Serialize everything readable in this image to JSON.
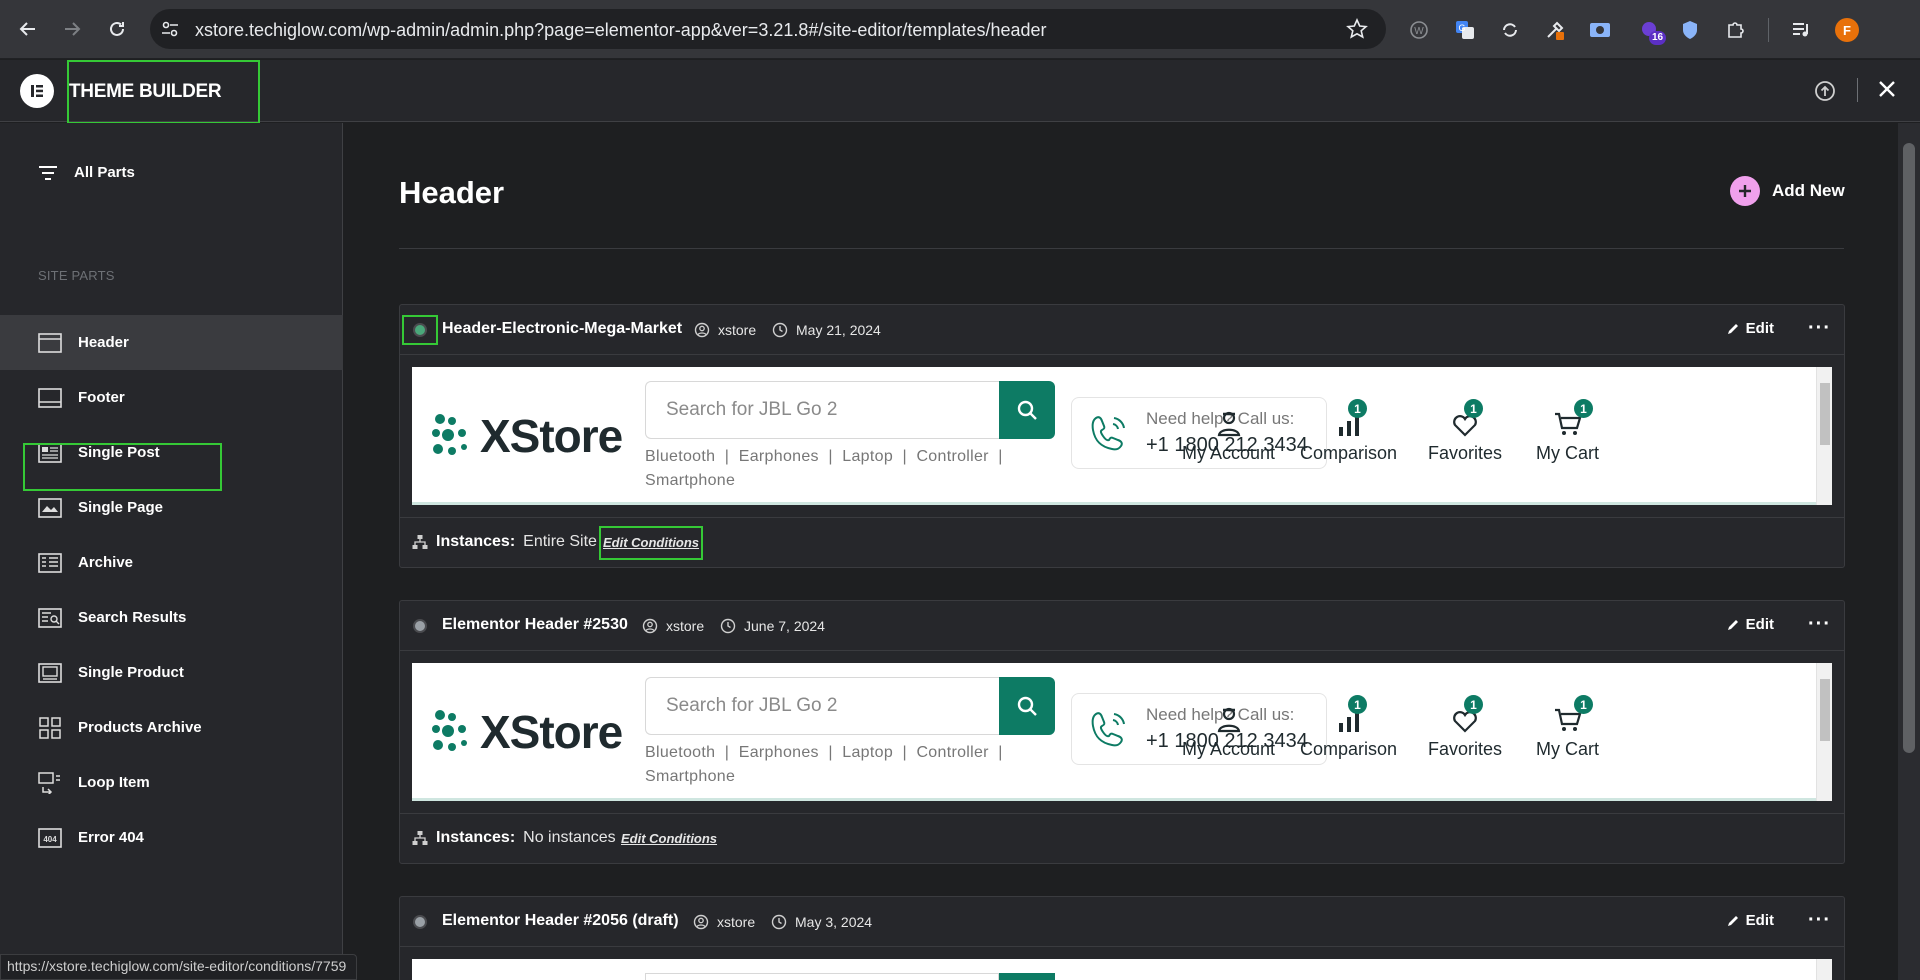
{
  "browser": {
    "url": "xstore.techiglow.com/wp-admin/admin.php?page=elementor-app&ver=3.21.8#/site-editor/templates/header",
    "extension_badge": "16",
    "profile_initial": "F",
    "status_url": "https://xstore.techiglow.com/site-editor/conditions/7759"
  },
  "app": {
    "title": "THEME BUILDER"
  },
  "sidebar": {
    "all_parts": "All Parts",
    "section_label": "SITE PARTS",
    "items": [
      {
        "label": "Header",
        "icon": "header-layout-icon"
      },
      {
        "label": "Footer",
        "icon": "footer-layout-icon"
      },
      {
        "label": "Single Post",
        "icon": "single-post-icon"
      },
      {
        "label": "Single Page",
        "icon": "single-page-icon"
      },
      {
        "label": "Archive",
        "icon": "archive-icon"
      },
      {
        "label": "Search Results",
        "icon": "search-results-icon"
      },
      {
        "label": "Single Product",
        "icon": "single-product-icon"
      },
      {
        "label": "Products Archive",
        "icon": "products-archive-icon"
      },
      {
        "label": "Loop Item",
        "icon": "loop-item-icon"
      },
      {
        "label": "Error 404",
        "icon": "error-404-icon"
      }
    ]
  },
  "main": {
    "title": "Header",
    "add_new": "Add New",
    "templates": [
      {
        "name": "Header-Electronic-Mega-Market",
        "author": "xstore",
        "date": "May 21, 2024",
        "edit": "Edit",
        "instances_label": "Instances:",
        "instances_value": "Entire Site",
        "edit_conditions": "Edit Conditions",
        "active": true
      },
      {
        "name": "Elementor Header #2530",
        "author": "xstore",
        "date": "June 7, 2024",
        "edit": "Edit",
        "instances_label": "Instances:",
        "instances_value": "No instances",
        "edit_conditions": "Edit Conditions",
        "active": false
      },
      {
        "name": "Elementor Header #2056 (draft)",
        "author": "xstore",
        "date": "May 3, 2024",
        "edit": "Edit",
        "active": false
      }
    ]
  },
  "preview": {
    "logo": "XStore",
    "search_placeholder": "Search for JBL Go 2",
    "tags_line1": "Bluetooth  |  Earphones  |  Laptop  |  Controller  |",
    "tags_line2": "Smartphone",
    "help_label": "Need help? Call us:",
    "help_phone": "+1 1800 212 3434",
    "my_account": "My Account",
    "comparison": "Comparison",
    "favorites": "Favorites",
    "my_cart": "My Cart",
    "count": "1"
  },
  "colors": {
    "accent_green": "#0d7b64",
    "highlight": "#35c936",
    "add_new_pink": "#f0a0ec"
  }
}
